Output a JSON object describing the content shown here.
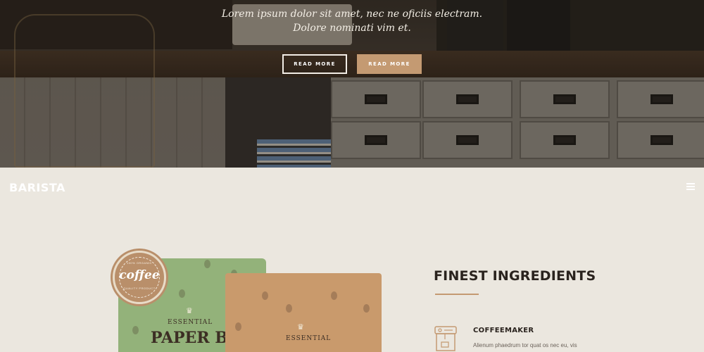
{
  "hero": {
    "line1": "Lorem ipsum dolor sit amet, nec ne oficiis electram.",
    "line2": "Dolore nominati vim et.",
    "btn_outline": "READ MORE",
    "btn_fill": "READ MORE"
  },
  "nav": {
    "logo": "BARISTA",
    "menu_icon": "hamburger-menu-icon"
  },
  "product": {
    "seal_top": "100% ORGANIC",
    "seal_word": "coffee",
    "seal_bottom": "QUALITY PRODUCT",
    "green_bag_brand": "ESSENTIAL",
    "green_bag_name": "PAPER BAG",
    "kraft_bag_brand": "ESSENTIAL"
  },
  "features": {
    "title": "FINEST INGREDIENTS",
    "items": [
      {
        "icon": "coffee-machine-icon",
        "title": "COFFEEMAKER",
        "desc": "Alienum phaedrum tor quat os nec eu, vis"
      }
    ]
  },
  "colors": {
    "accent": "#c49a72",
    "background": "#ebe7df",
    "heading": "#2a231e"
  }
}
